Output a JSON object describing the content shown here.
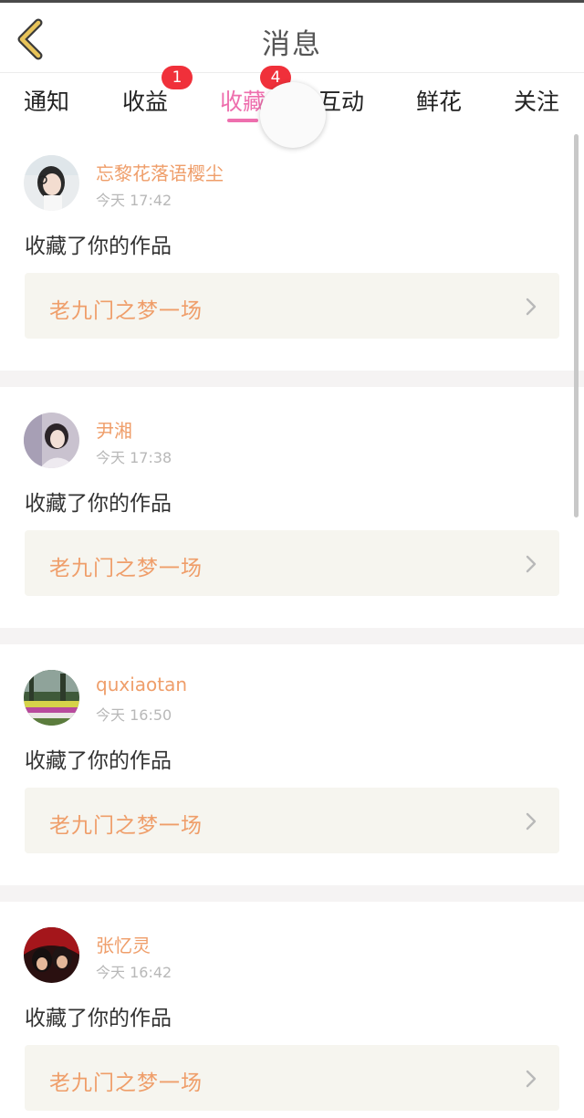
{
  "header": {
    "title": "消息"
  },
  "tabs": [
    {
      "label": "通知"
    },
    {
      "label": "收益",
      "badge": "1"
    },
    {
      "label": "收藏",
      "badge": "4",
      "active": true
    },
    {
      "label": "互动"
    },
    {
      "label": "鲜花"
    },
    {
      "label": "关注"
    }
  ],
  "items": [
    {
      "name": "忘黎花落语樱尘",
      "time": "今天 17:42",
      "action": "收藏了你的作品",
      "work": "老九门之梦一场"
    },
    {
      "name": "尹湘",
      "time": "今天 17:38",
      "action": "收藏了你的作品",
      "work": "老九门之梦一场"
    },
    {
      "name": "quxiaotan",
      "time": "今天 16:50",
      "action": "收藏了你的作品",
      "work": "老九门之梦一场"
    },
    {
      "name": "张忆灵",
      "time": "今天 16:42",
      "action": "收藏了你的作品",
      "work": "老九门之梦一场"
    }
  ],
  "colors": {
    "accent": "#ee6fae",
    "username": "#ef9e6a",
    "badge": "#f0303a",
    "back_icon": "#e8c45a"
  },
  "icons": {
    "back": "chevron-left-icon",
    "row": "chevron-right-icon"
  }
}
